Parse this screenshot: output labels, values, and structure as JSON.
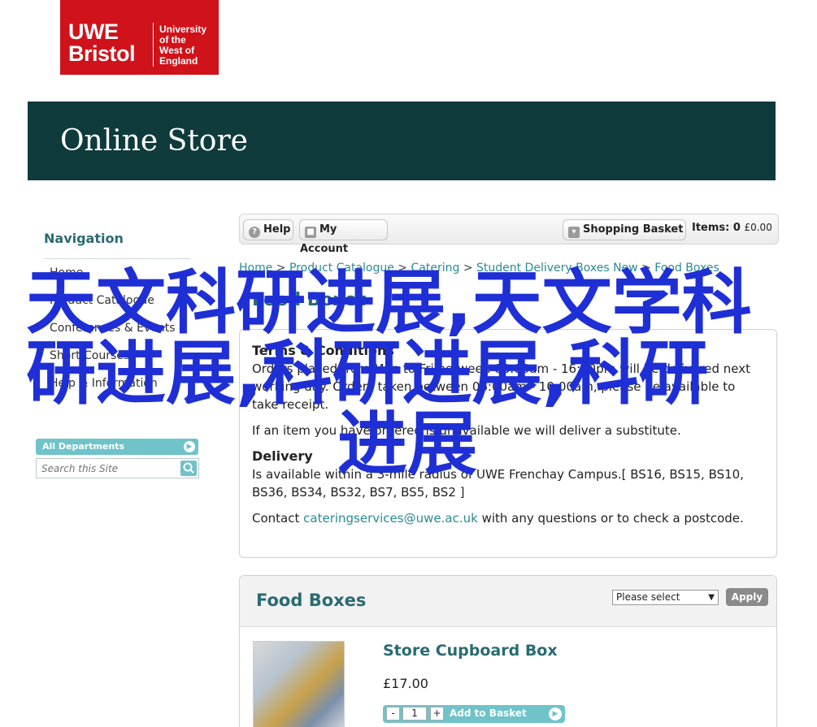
{
  "logo": {
    "line1": "UWE",
    "line2": "Bristol",
    "uni_line1": "University",
    "uni_line2": "of the",
    "uni_line3": "West of",
    "uni_line4": "England"
  },
  "banner": {
    "title": "Online Store"
  },
  "sidebar": {
    "title": "Navigation",
    "items": [
      {
        "label": "Home"
      },
      {
        "label": "Product Catalogue"
      },
      {
        "label": "Conferences & Events"
      },
      {
        "label": "Short Courses"
      },
      {
        "label": "Help & Information"
      }
    ],
    "departments": "All Departments",
    "search_placeholder": "Search this Site"
  },
  "toolbar": {
    "help": "Help",
    "account": "My Account",
    "basket": "Shopping Basket",
    "items_label": "Items:",
    "items_count": "0",
    "items_price": "£0.00"
  },
  "breadcrumb": {
    "items": [
      "Home",
      "Product Catalogue",
      "Catering",
      "Student Delivery Boxes New",
      "Food Boxes"
    ],
    "separator": ">"
  },
  "page_title": "Food Boxes",
  "terms": {
    "heading": "Terms & Conditions",
    "p1": "Orders placed from Mon to Fri between 08:00am - 16:00pm will be delivered next working day. Orders taken between 06:00am - 10:00am, please be available to take receipt.",
    "p2": "If an item you have ordered is unavailable we will deliver a substitute.",
    "delivery_heading": "Delivery",
    "delivery_text": "Is available within a 3-mile radius of UWE Frenchay Campus.[ BS16, BS15, BS10, BS36, BS34, BS32, BS7, BS5, BS2 ]",
    "contact_prefix": "Contact",
    "contact_email": "cateringservices@uwe.ac.uk",
    "contact_suffix": "with any questions or to check a postcode."
  },
  "food_boxes": {
    "title": "Food Boxes",
    "select_value": "Please select",
    "apply": "Apply",
    "product": {
      "name": "Store Cupboard Box",
      "price": "£17.00",
      "quantity": "1",
      "add_label": "Add to Basket"
    }
  },
  "watermark": {
    "line1": "天文科研进展,天文学科",
    "line2": "研进展,科研进展,科研",
    "line3": "进展",
    "color": "#1f2fd6"
  }
}
